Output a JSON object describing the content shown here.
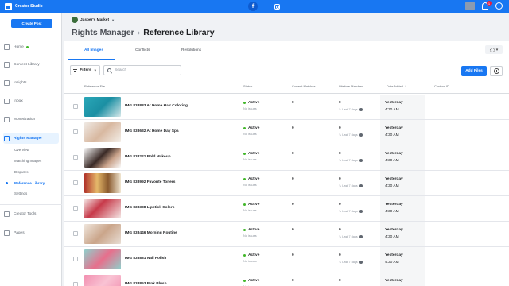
{
  "app": {
    "title": "Creator Studio"
  },
  "topbar": {
    "facebook_icon": "f",
    "notif_count": "1"
  },
  "sidebar": {
    "create_button": "Create Post",
    "items": [
      {
        "label": "Home",
        "icon": "home-icon"
      },
      {
        "label": "Content Library",
        "icon": "library-icon"
      },
      {
        "label": "Insights",
        "icon": "insights-icon"
      },
      {
        "label": "Inbox",
        "icon": "inbox-icon"
      },
      {
        "label": "Monetization",
        "icon": "monetization-icon"
      },
      {
        "label": "Rights Manager",
        "icon": "rights-icon"
      },
      {
        "label": "Creator Tools",
        "icon": "tools-icon"
      },
      {
        "label": "Pages",
        "icon": "pages-icon"
      }
    ],
    "subitems": [
      "Overview",
      "Matching Images",
      "Disputes",
      "Reference Library",
      "Settings"
    ]
  },
  "header": {
    "page_name": "Jasper's Market",
    "breadcrumb_parent": "Rights Manager",
    "breadcrumb_sep": "›",
    "breadcrumb_current": "Reference Library"
  },
  "tabs": [
    "All Images",
    "Conflicts",
    "Resolutions"
  ],
  "toolbar": {
    "filters_label": "Filters",
    "search_placeholder": "Search",
    "add_button": "Add Files"
  },
  "table": {
    "headers": [
      "Reference File",
      "Status",
      "Current Matches",
      "Lifetime Matches",
      "Date Added ↓",
      "Custom ID"
    ],
    "rows": [
      {
        "name": "IMG 833883 At Home Hair Coloring",
        "status": "Active",
        "status_sub": "No issues",
        "current": "0",
        "lifetime": "0",
        "lifetime_sub": "↳ Last 7 days",
        "date": "Yesterday",
        "time": "4:30 AM"
      },
      {
        "name": "IMG 833632 At Home Day Spa",
        "status": "Active",
        "status_sub": "No issues",
        "current": "0",
        "lifetime": "0",
        "lifetime_sub": "↳ Last 7 days",
        "date": "Yesterday",
        "time": "4:30 AM"
      },
      {
        "name": "IMG 833221 Bold Makeup",
        "status": "Active",
        "status_sub": "No issues",
        "current": "0",
        "lifetime": "0",
        "lifetime_sub": "↳ Last 7 days",
        "date": "Yesterday",
        "time": "4:30 AM"
      },
      {
        "name": "IMG 833992 Favorite Toners",
        "status": "Active",
        "status_sub": "No issues",
        "current": "0",
        "lifetime": "0",
        "lifetime_sub": "↳ Last 7 days",
        "date": "Yesterday",
        "time": "4:30 AM"
      },
      {
        "name": "IMG 833338 Lipstick Colors",
        "status": "Active",
        "status_sub": "No issues",
        "current": "0",
        "lifetime": "0",
        "lifetime_sub": "↳ Last 7 days",
        "date": "Yesterday",
        "time": "4:30 AM"
      },
      {
        "name": "IMG 833446 Morning Routine",
        "status": "Active",
        "status_sub": "No issues",
        "current": "0",
        "lifetime": "0",
        "lifetime_sub": "↳ Last 7 days",
        "date": "Yesterday",
        "time": "4:30 AM"
      },
      {
        "name": "IMG 833881 Nail Polish",
        "status": "Active",
        "status_sub": "No issues",
        "current": "0",
        "lifetime": "0",
        "lifetime_sub": "↳ Last 7 days",
        "date": "Yesterday",
        "time": "4:30 AM"
      },
      {
        "name": "IMG 833853 Pink Blush",
        "status": "Active",
        "status_sub": "No issues",
        "current": "0",
        "lifetime": "0",
        "lifetime_sub": "↳ Last 7 days",
        "date": "Yesterday",
        "time": "4:30 AM"
      }
    ]
  },
  "colors": {
    "accent": "#1877f2",
    "active_dot": "#42b72a"
  }
}
